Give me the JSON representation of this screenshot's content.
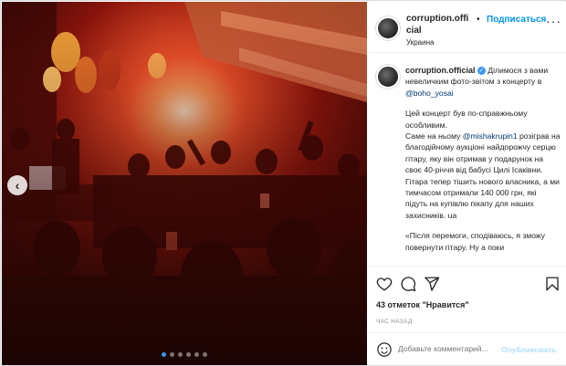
{
  "post": {
    "photo": {
      "description_icon": "concert-crowd-photo",
      "carousel_count": 6,
      "carousel_active": 0
    },
    "header": {
      "username": "corruption.official",
      "dot": "•",
      "follow_label": "Подписаться",
      "location": "Украина",
      "more_icon": "more-horizontal-icon"
    },
    "caption": {
      "username": "corruption.official",
      "intro_before": " Ділимося з вами невеличким фото-звітом з концерту в ",
      "mention_venue": "@boho_yosai",
      "para2_line1": "Цей концерт був по-справжньому особливим.",
      "para2_before": "Саме на ньому ",
      "mention_person": "@mishakrupin1",
      "para2_after": " розіграв на благодійному аукціоні найдорожчу серцю гітару, яку він отримав у подарунок на своє 40-річчя від бабусі Цилі Ісаківни. Гітара тепер тішить нового власника, а ми тимчасом отримали 140 000 грн, які підуть на купівлю пікапу для наших захисників. ua",
      "para3": "«Після перемоги, сподіваюсь, я зможу повернути гітару. Ну а поки"
    },
    "actions": {
      "likes": "43 отметок \"Нравится\"",
      "time": "ЧАС НАЗАД"
    },
    "comment": {
      "placeholder": "Добавьте комментарий...",
      "publish_label": "Опубликовать"
    }
  }
}
